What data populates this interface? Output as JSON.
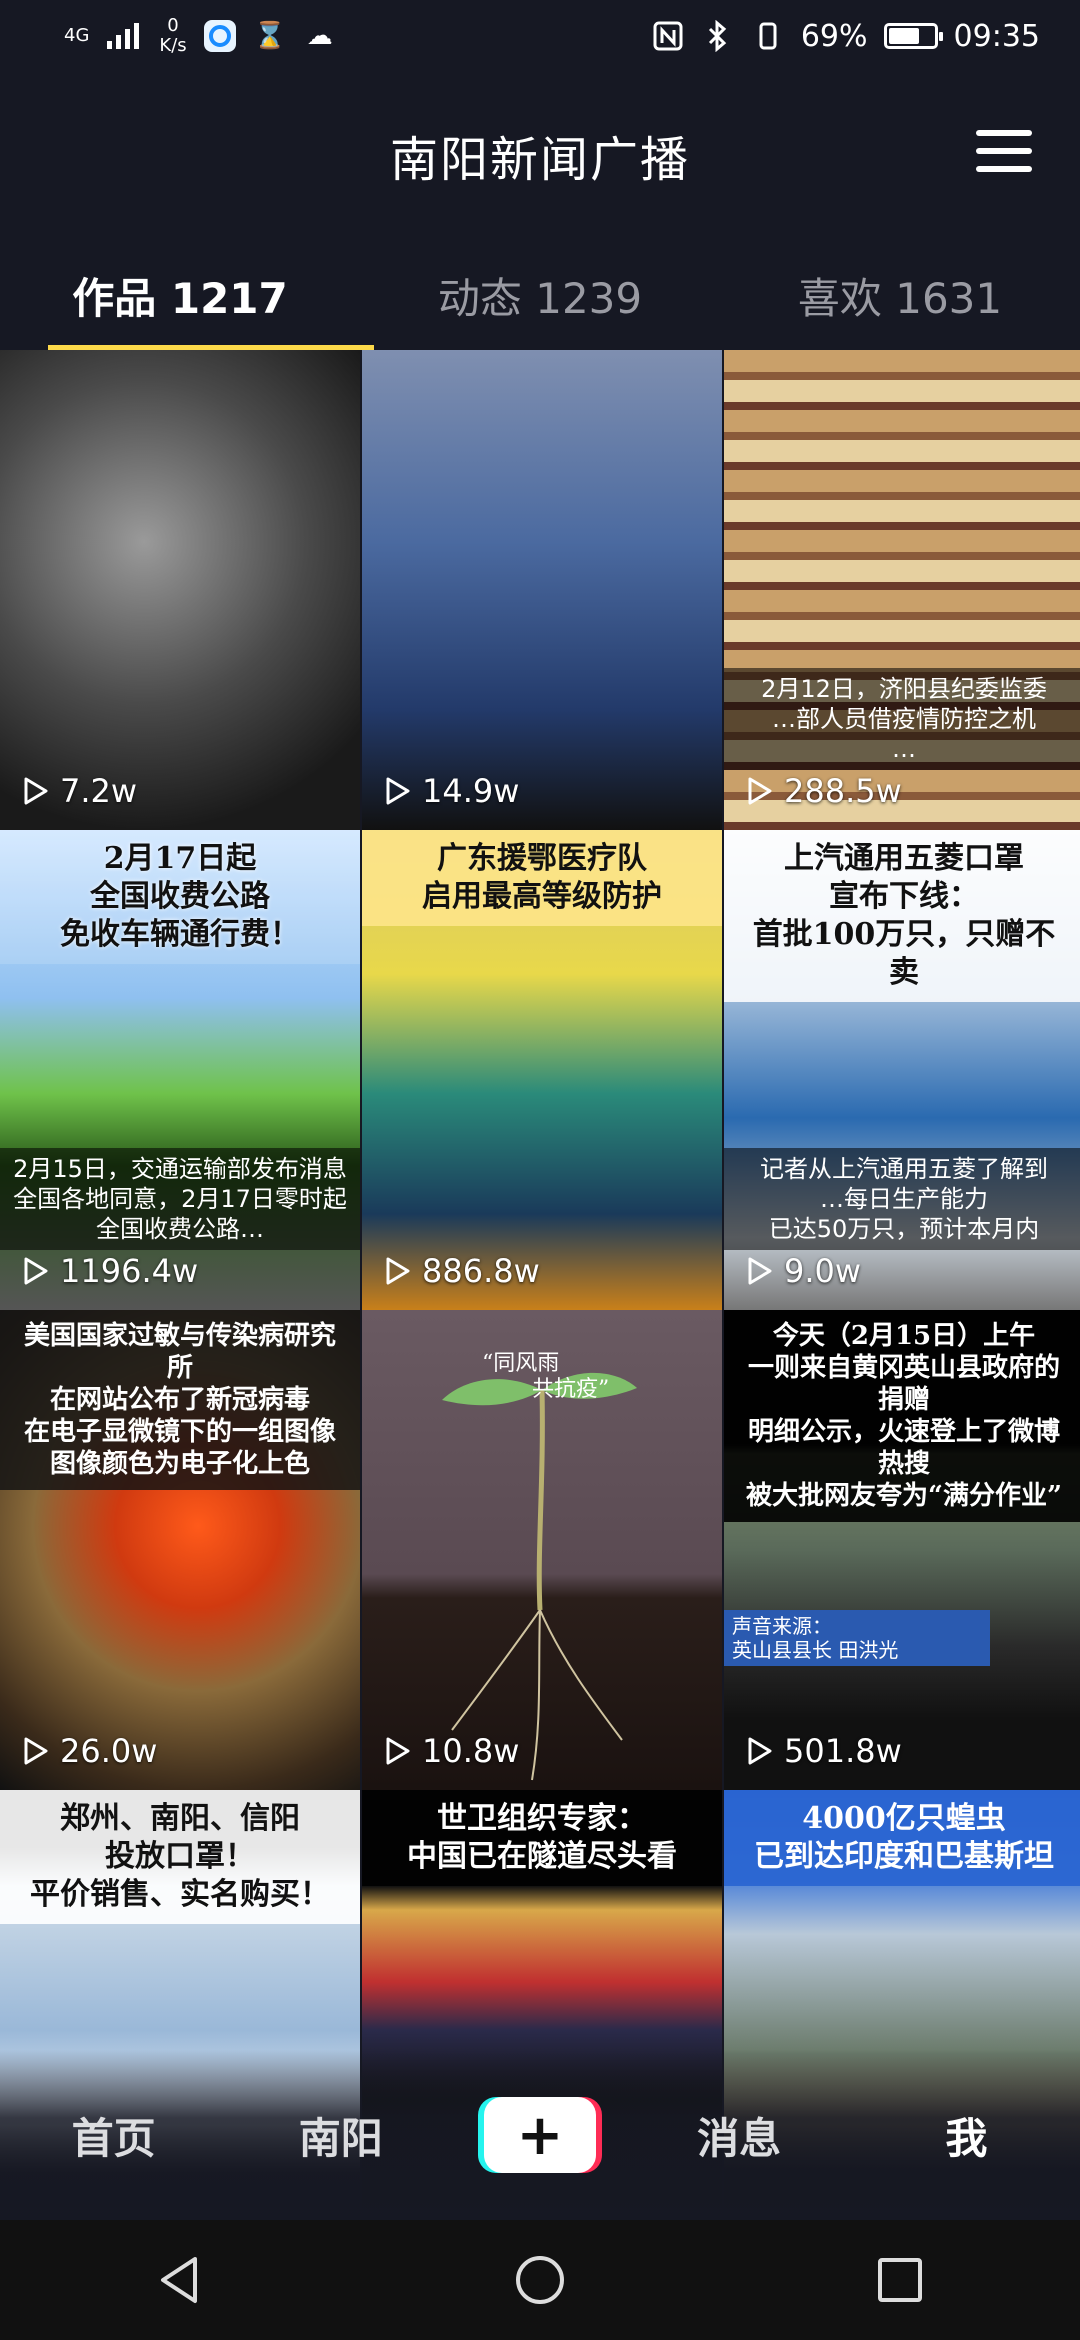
{
  "status_bar": {
    "network": "4G",
    "speed_value": "0",
    "speed_unit": "K/s",
    "battery": "69%",
    "battery_level": 0.69,
    "time": "09:35",
    "icons": [
      "signal-icon",
      "app-icon",
      "hourglass-icon",
      "cloud-icon",
      "nfc-icon",
      "bluetooth-icon",
      "vibrate-icon"
    ]
  },
  "header": {
    "title": "南阳新闻广播"
  },
  "tabs": [
    {
      "label": "作品 1217",
      "active": true
    },
    {
      "label": "动态 1239",
      "active": false
    },
    {
      "label": "喜欢 1631",
      "active": false
    }
  ],
  "videos": [
    {
      "views": "7.2w",
      "top": "",
      "bottom": ""
    },
    {
      "views": "14.9w",
      "top": "",
      "bottom": ""
    },
    {
      "views": "288.5w",
      "top": "",
      "bottom": "2月12日，济阳县纪委监委\n…部人员借疫情防控之机\n…"
    },
    {
      "views": "1196.4w",
      "top": "2月17日起\n全国收费公路\n免收车辆通行费！",
      "bottom": "2月15日，交通运输部发布消息\n全国各地同意，2月17日零时起\n全国收费公路…"
    },
    {
      "views": "886.8w",
      "top": "广东援鄂医疗队\n启用最高等级防护",
      "bottom": ""
    },
    {
      "views": "9.0w",
      "top": "上汽通用五菱口罩\n宣布下线：\n首批100万只，只赠不卖",
      "bottom": "记者从上汽通用五菱了解到\n…每日生产能力\n已达50万只，预计本月内"
    },
    {
      "views": "26.0w",
      "top": "美国国家过敏与传染病研究所\n在网站公布了新冠病毒\n在电子显微镜下的一组图像\n图像颜色为电子化上色",
      "bottom": ""
    },
    {
      "views": "10.8w",
      "top": "",
      "bottom": ""
    },
    {
      "views": "501.8w",
      "top": "今天（2月15日）上午\n一则来自黄冈英山县政府的捐赠\n明细公示，火速登上了微博热搜\n被大批网友夸为“满分作业”",
      "bottom": ""
    },
    {
      "views": "",
      "top": "郑州、南阳、信阳\n投放口罩！\n平价销售、实名购买！",
      "bottom": ""
    },
    {
      "views": "",
      "top": "世卫组织专家：\n中国已在隧道尽头看",
      "bottom": ""
    },
    {
      "views": "",
      "top": "4000亿只蝗虫\n已到达印度和巴基斯坦",
      "bottom": ""
    }
  ],
  "overlay_texts": {
    "sprout_left": "“同风雨",
    "sprout_right": "共抗疫”",
    "news_source_1": "声音来源：",
    "news_source_2": "英山县县长 田洪光"
  },
  "bottom_nav": [
    {
      "label": "首页",
      "active": false
    },
    {
      "label": "南阳",
      "active": false
    },
    {
      "label": "+",
      "active": false
    },
    {
      "label": "消息",
      "active": false
    },
    {
      "label": "我",
      "active": true
    }
  ],
  "colors": {
    "background": "#161823",
    "tab_indicator": "#fdd94a",
    "plus_cyan": "#25f4ee",
    "plus_red": "#fe2c55"
  }
}
